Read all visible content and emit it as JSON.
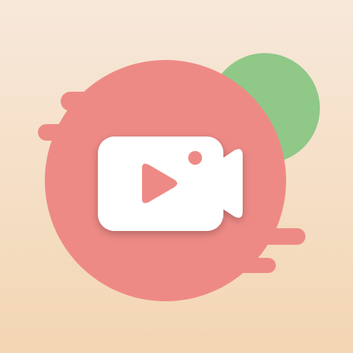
{
  "icon": {
    "name": "video-camera-play-icon",
    "colors": {
      "background_top": "#F7E8DA",
      "background_bottom": "#F3D6B3",
      "main_circle": "#EE8A86",
      "accent_circle": "#90C888",
      "camera_body": "#FFFFFF",
      "play_triangle": "#EE8A86",
      "camera_dot": "#EE8A86",
      "shadow": "#C86A66"
    }
  }
}
